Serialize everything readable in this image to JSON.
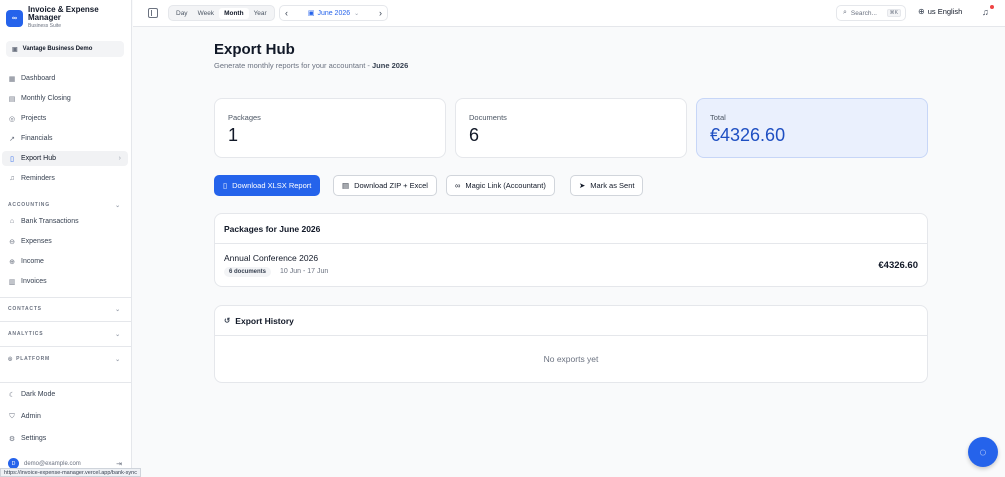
{
  "app": {
    "title": "Invoice & Expense Manager",
    "subtitle": "Business Suite",
    "logo_text": "∞",
    "workspace": "Vantage Business Demo"
  },
  "sidebar": {
    "items": [
      {
        "label": "Dashboard",
        "icon": "grid-icon"
      },
      {
        "label": "Monthly Closing",
        "icon": "clipboard-icon"
      },
      {
        "label": "Projects",
        "icon": "target-icon"
      },
      {
        "label": "Financials",
        "icon": "trend-icon"
      },
      {
        "label": "Export Hub",
        "icon": "file-icon",
        "active": true
      },
      {
        "label": "Reminders",
        "icon": "bell-icon"
      }
    ],
    "accounting_label": "ACCOUNTING",
    "accounting_items": [
      {
        "label": "Bank Transactions",
        "icon": "bank-icon"
      },
      {
        "label": "Expenses",
        "icon": "expense-icon"
      },
      {
        "label": "Income",
        "icon": "income-icon"
      },
      {
        "label": "Invoices",
        "icon": "invoice-icon"
      }
    ],
    "contacts_label": "CONTACTS",
    "analytics_label": "ANALYTICS",
    "platform_label": "PLATFORM",
    "bottom_items": [
      {
        "label": "Dark Mode",
        "icon": "moon-icon"
      },
      {
        "label": "Admin",
        "icon": "shield-icon"
      },
      {
        "label": "Settings",
        "icon": "gear-icon"
      }
    ],
    "user_email": "demo@example.com",
    "user_initial": "D"
  },
  "status_url": "https://invoice-expense-manager.vercel.app/bank-sync",
  "topbar": {
    "views": [
      "Day",
      "Week",
      "Month",
      "Year"
    ],
    "selected_view": "Month",
    "month": "June 2026",
    "search_placeholder": "Search...",
    "search_shortcut": "⌘K",
    "language": "us English"
  },
  "main": {
    "title": "Export Hub",
    "subtitle_prefix": "Generate monthly reports for your accountant - ",
    "subtitle_month": "June 2026",
    "stats": {
      "packages_label": "Packages",
      "packages_value": "1",
      "documents_label": "Documents",
      "documents_value": "6",
      "total_label": "Total",
      "total_value": "€4326.60"
    },
    "actions": {
      "download_xlsx": "Download XLSX Report",
      "download_zip": "Download ZIP + Excel",
      "magic_link": "Magic Link (Accountant)",
      "mark_sent": "Mark as Sent"
    },
    "packages": {
      "title": "Packages for June 2026",
      "items": [
        {
          "name": "Annual Conference 2026",
          "docs": "6 documents",
          "dates": "10 Jun - 17 Jun",
          "amount": "€4326.60"
        }
      ]
    },
    "history": {
      "title": "Export History",
      "empty": "No exports yet"
    }
  }
}
